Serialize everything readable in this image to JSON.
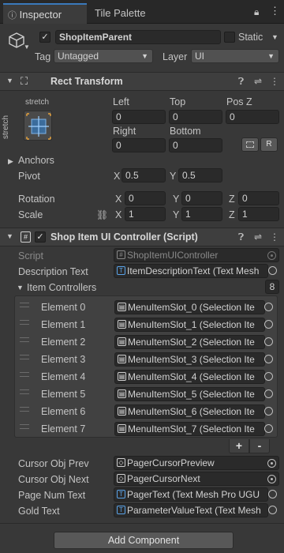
{
  "tabs": {
    "inspector": "Inspector",
    "tile_palette": "Tile Palette"
  },
  "gameobject": {
    "name": "ShopItemParent",
    "static_label": "Static",
    "tag_label": "Tag",
    "tag_value": "Untagged",
    "layer_label": "Layer",
    "layer_value": "UI"
  },
  "rect_transform": {
    "title": "Rect Transform",
    "anchor_top": "stretch",
    "anchor_side": "stretch",
    "headers": {
      "left": "Left",
      "top": "Top",
      "posz": "Pos Z",
      "right": "Right",
      "bottom": "Bottom"
    },
    "values": {
      "left": "0",
      "top": "0",
      "posz": "0",
      "right": "0",
      "bottom": "0"
    },
    "r_button": "R",
    "anchors_label": "Anchors",
    "pivot_label": "Pivot",
    "pivot": {
      "x": "0.5",
      "y": "0.5"
    },
    "rotation_label": "Rotation",
    "rotation": {
      "x": "0",
      "y": "0",
      "z": "0"
    },
    "scale_label": "Scale",
    "scale": {
      "x": "1",
      "y": "1",
      "z": "1"
    },
    "axes": {
      "x": "X",
      "y": "Y",
      "z": "Z"
    }
  },
  "controller": {
    "title": "Shop Item UI Controller (Script)",
    "script_label": "Script",
    "script_value": "ShopItemUIController",
    "description_label": "Description Text",
    "description_value": "ItemDescriptionText (Text Mesh",
    "item_controllers_label": "Item Controllers",
    "item_controllers_count": "8",
    "elements": [
      {
        "label": "Element 0",
        "value": "MenuItemSlot_0 (Selection Ite"
      },
      {
        "label": "Element 1",
        "value": "MenuItemSlot_1 (Selection Ite"
      },
      {
        "label": "Element 2",
        "value": "MenuItemSlot_2 (Selection Ite"
      },
      {
        "label": "Element 3",
        "value": "MenuItemSlot_3 (Selection Ite"
      },
      {
        "label": "Element 4",
        "value": "MenuItemSlot_4 (Selection Ite"
      },
      {
        "label": "Element 5",
        "value": "MenuItemSlot_5 (Selection Ite"
      },
      {
        "label": "Element 6",
        "value": "MenuItemSlot_6 (Selection Ite"
      },
      {
        "label": "Element 7",
        "value": "MenuItemSlot_7 (Selection Ite"
      }
    ],
    "add_symbol": "+",
    "remove_symbol": "-",
    "cursor_prev_label": "Cursor Obj Prev",
    "cursor_prev_value": "PagerCursorPreview",
    "cursor_next_label": "Cursor Obj Next",
    "cursor_next_value": "PagerCursorNext",
    "page_num_label": "Page Num Text",
    "page_num_value": "PagerText (Text Mesh Pro UGU",
    "gold_label": "Gold Text",
    "gold_value": "ParameterValueText (Text Mesh"
  },
  "add_component": "Add Component",
  "colors": {
    "accent": "#3a79bb",
    "background": "#383838",
    "field": "#2a2a2a"
  }
}
